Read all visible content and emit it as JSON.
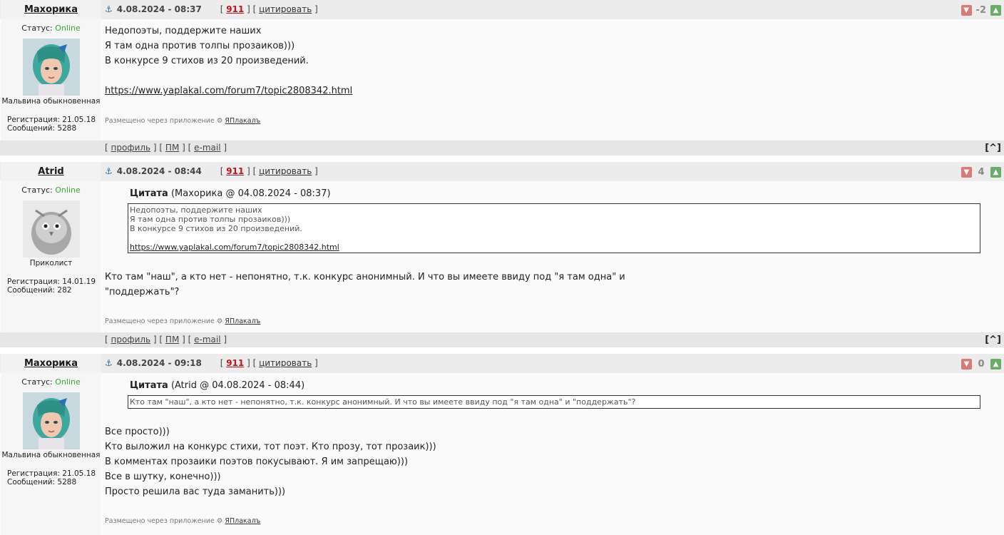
{
  "common": {
    "status_label": "Статус:",
    "status_value": "Online",
    "reg_label": "Регистрация:",
    "posts_label": "Сообщений:",
    "quote_btn": "цитировать",
    "quote_title": "Цитата",
    "via_text": "Размещено через приложение",
    "app_name": "ЯПлакалъ",
    "profile_link": "профиль",
    "pm_link": "ПМ",
    "email_link": "e-mail",
    "to_top": "[^]",
    "anchor_icon": "⚓"
  },
  "posts": [
    {
      "author": "Махорика",
      "date": "4.08.2024 - 08:37",
      "num": "911",
      "score": "-2",
      "rank": "Мальвина обыкновенная",
      "reg_date": "21.05.18",
      "post_count": "5288",
      "lines": [
        "Недопоэты, поддержите наших",
        "Я там одна против толпы прозаиков)))",
        "В конкурсе 9 стихов из 20 произведений."
      ],
      "link": "https://www.yaplakal.com/forum7/topic2808342.html"
    },
    {
      "author": "Atrid",
      "date": "4.08.2024 - 08:44",
      "num": "911",
      "score": "4",
      "rank": "Приколист",
      "reg_date": "14.01.19",
      "post_count": "282",
      "quote_from": "(Махорика @ 04.08.2024 - 08:37)",
      "quote_lines": [
        "Недопоэты, поддержите наших",
        "Я там одна против толпы прозаиков)))",
        "В конкурсе 9 стихов из 20 произведений."
      ],
      "quote_link": "https://www.yaplakal.com/forum7/topic2808342.html",
      "lines": [
        "Кто там \"наш\", а кто нет - непонятно, т.к. конкурс анонимный. И что вы имеете ввиду под \"я там одна\" и",
        "\"поддержать\"?"
      ]
    },
    {
      "author": "Махорика",
      "date": "4.08.2024 - 09:18",
      "num": "911",
      "score": "0",
      "rank": "Мальвина обыкновенная",
      "reg_date": "21.05.18",
      "post_count": "5288",
      "quote_from": "(Atrid @ 04.08.2024 - 08:44)",
      "quote_text": "Кто там \"наш\", а кто нет - непонятно, т.к. конкурс анонимный. И что вы имеете ввиду под \"я там одна\" и \"поддержать\"?",
      "lines": [
        "Все просто)))",
        "Кто выложил на конкурс стихи, тот поэт. Кто прозу, тот прозаик)))",
        "В комментах прозаики поэтов покусывают. Я им запрещаю)))",
        "Все в шутку, конечно)))",
        "Просто решила вас туда заманить)))"
      ]
    }
  ],
  "icons": {
    "vote_down": "thumbs-down-icon",
    "vote_up": "thumbs-up-icon",
    "android": "android-icon",
    "colors": {
      "vote_down": "#d87a7a",
      "vote_up": "#6aab6a",
      "online": "#3aa43a",
      "post_num": "#c0141e"
    }
  }
}
